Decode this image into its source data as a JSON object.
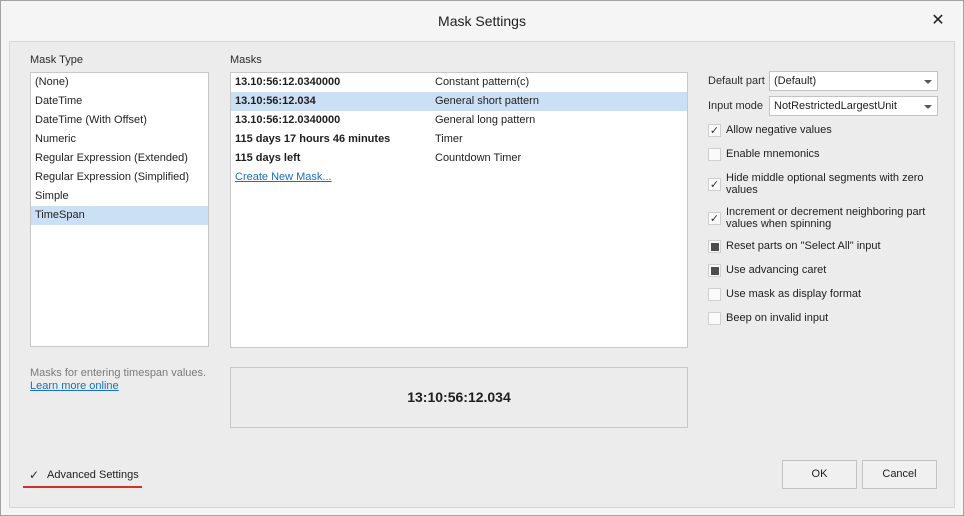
{
  "window": {
    "title": "Mask Settings"
  },
  "mask_type": {
    "label": "Mask Type",
    "items": [
      "(None)",
      "DateTime",
      "DateTime (With Offset)",
      "Numeric",
      "Regular Expression (Extended)",
      "Regular Expression (Simplified)",
      "Simple",
      "TimeSpan"
    ],
    "selected": "TimeSpan"
  },
  "masks": {
    "label": "Masks",
    "rows": [
      {
        "value": "13.10:56:12.0340000",
        "desc": "Constant pattern(c)"
      },
      {
        "value": "13.10:56:12.034",
        "desc": "General short pattern"
      },
      {
        "value": "13.10:56:12.0340000",
        "desc": "General long pattern"
      },
      {
        "value": "115 days 17 hours 46 minutes",
        "desc": "Timer"
      },
      {
        "value": "115 days left",
        "desc": "Countdown Timer"
      }
    ],
    "selected_index": 1,
    "create_link": "Create New Mask..."
  },
  "hint": {
    "text": "Masks for entering timespan values.",
    "link": "Learn more online"
  },
  "preview": {
    "value": "13:10:56:12.034"
  },
  "options": {
    "default_part_label": "Default part",
    "default_part_value": "(Default)",
    "input_mode_label": "Input mode",
    "input_mode_value": "NotRestrictedLargestUnit",
    "checkboxes": [
      {
        "label": "Allow negative values",
        "state": "checked"
      },
      {
        "label": "Enable mnemonics",
        "state": "unchecked"
      },
      {
        "label": "Hide middle optional segments with zero values",
        "state": "checked"
      },
      {
        "label": "Increment or decrement neighboring part values when spinning",
        "state": "checked"
      },
      {
        "label": "Reset parts on \"Select All\" input",
        "state": "indeterminate"
      },
      {
        "label": "Use advancing caret",
        "state": "indeterminate"
      },
      {
        "label": "Use mask as display format",
        "state": "unchecked"
      },
      {
        "label": "Beep on invalid input",
        "state": "unchecked"
      }
    ]
  },
  "footer": {
    "advanced_label": "Advanced Settings",
    "advanced_checked": true,
    "ok_label": "OK",
    "cancel_label": "Cancel"
  },
  "colors": {
    "selection": "#cce0f5",
    "link": "#1a6fc4",
    "highlight_underline": "#d0312d"
  }
}
